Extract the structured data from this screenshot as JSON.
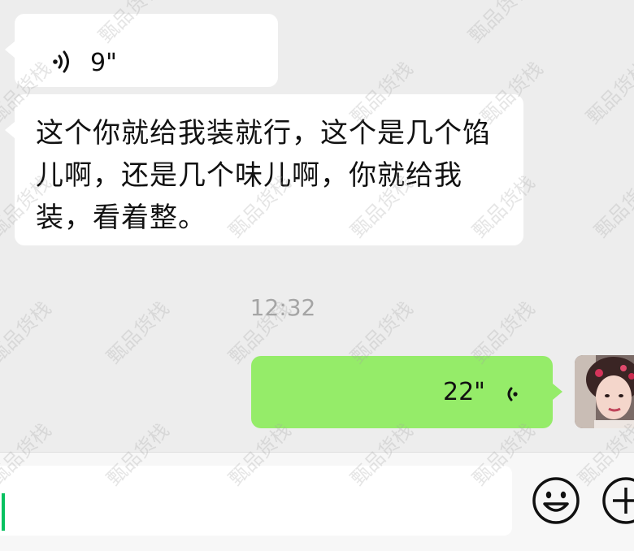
{
  "chat": {
    "messages": [
      {
        "type": "voice",
        "side": "left",
        "duration": "9\""
      },
      {
        "type": "text",
        "side": "left",
        "text": "这个你就给我装就行，这个是几个馅儿啊，还是几个味儿啊，你就给我装，看着整。"
      },
      {
        "type": "timestamp",
        "text": "12:32"
      },
      {
        "type": "voice",
        "side": "right",
        "duration": "22\""
      }
    ]
  },
  "input": {
    "value": ""
  },
  "icons": {
    "voice_in": "voice-wave-icon",
    "voice_out": "voice-wave-icon",
    "emoji": "smiley-icon",
    "plus": "plus-icon"
  },
  "watermark": {
    "text": "甄品货栈"
  },
  "colors": {
    "background": "#ededed",
    "incoming_bubble": "#ffffff",
    "outgoing_bubble": "#95ec69",
    "caret": "#07c160",
    "timestamp": "#a5a5a5"
  }
}
